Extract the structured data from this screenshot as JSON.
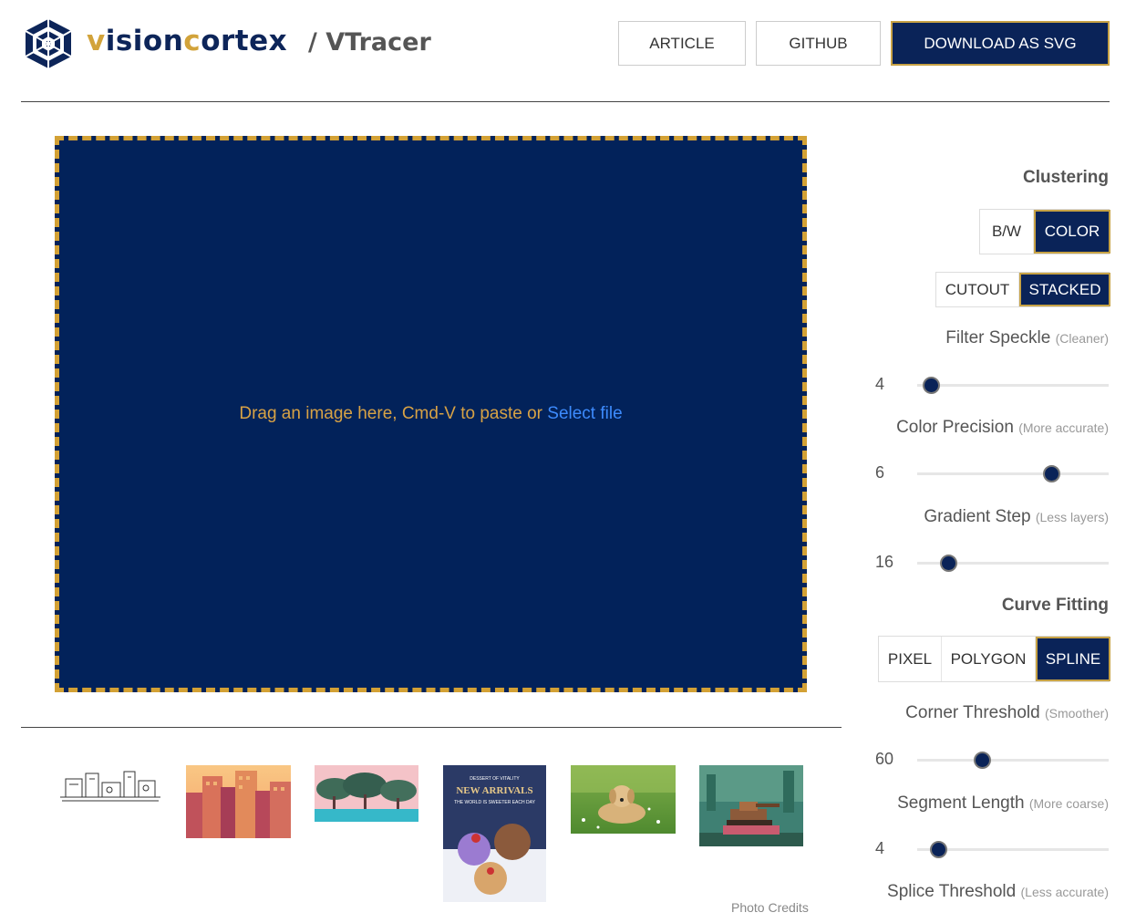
{
  "header": {
    "brand_v": "v",
    "brand_a": "ision",
    "brand_c": "c",
    "brand_b": "ortex",
    "subtitle": "/ VTracer",
    "buttons": {
      "article": "ARTICLE",
      "github": "GITHUB",
      "download": "DOWNLOAD AS SVG"
    }
  },
  "dropzone": {
    "text": "Drag an image here, Cmd-V to paste or ",
    "link": "Select file"
  },
  "gallery": {
    "credits": "Photo Credits",
    "items": [
      "sketch-drawing",
      "city-skyline",
      "trees-landscape",
      "new-arrivals-poster",
      "dog-on-grass",
      "pixel-art-tank"
    ],
    "poster": {
      "top": "DESSERT OF VITALITY",
      "title": "NEW ARRIVALS",
      "sub": "THE WORLD IS SWEETER EACH DAY"
    }
  },
  "panel": {
    "clustering": {
      "title": "Clustering",
      "mode_options": [
        "B/W",
        "COLOR"
      ],
      "mode_selected": "COLOR",
      "hier_options": [
        "CUTOUT",
        "STACKED"
      ],
      "hier_selected": "STACKED"
    },
    "sliders": [
      {
        "label": "Filter Speckle",
        "hint": "(Cleaner)",
        "value": "4",
        "fraction": 0.07
      },
      {
        "label": "Color Precision",
        "hint": "(More accurate)",
        "value": "6",
        "fraction": 0.7
      },
      {
        "label": "Gradient Step",
        "hint": "(Less layers)",
        "value": "16",
        "fraction": 0.16
      }
    ],
    "curve_fitting": {
      "title": "Curve Fitting",
      "options": [
        "PIXEL",
        "POLYGON",
        "SPLINE"
      ],
      "selected": "SPLINE"
    },
    "curve_sliders": [
      {
        "label": "Corner Threshold",
        "hint": "(Smoother)",
        "value": "60",
        "fraction": 0.34
      },
      {
        "label": "Segment Length",
        "hint": "(More coarse)",
        "value": "4",
        "fraction": 0.11
      },
      {
        "label": "Splice Threshold",
        "hint": "(Less accurate)"
      }
    ]
  },
  "colors": {
    "navy": "#0a2358",
    "gold": "#d3a135",
    "link": "#3d8bfd"
  }
}
